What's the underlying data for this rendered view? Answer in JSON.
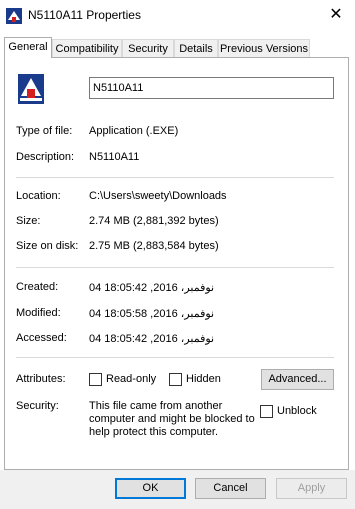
{
  "window": {
    "title": "N5110A11 Properties",
    "close_glyph": "✕"
  },
  "tabs": [
    "General",
    "Compatibility",
    "Security",
    "Details",
    "Previous Versions"
  ],
  "file": {
    "name": "N5110A11"
  },
  "details": {
    "type_label": "Type of file:",
    "type_value": "Application (.EXE)",
    "description_label": "Description:",
    "description_value": "N5110A11",
    "location_label": "Location:",
    "location_value": "C:\\Users\\sweety\\Downloads",
    "size_label": "Size:",
    "size_value": "2.74 MB (2,881,392 bytes)",
    "size_on_disk_label": "Size on disk:",
    "size_on_disk_value": "2.75 MB (2,883,584 bytes)",
    "created_label": "Created:",
    "created_value": "04 نوفمبر، 2016, 18:05:42",
    "modified_label": "Modified:",
    "modified_value": "04 نوفمبر، 2016, 18:05:58",
    "accessed_label": "Accessed:",
    "accessed_value": "04 نوفمبر، 2016, 18:05:42"
  },
  "attributes": {
    "label": "Attributes:",
    "readonly_label": "Read-only",
    "hidden_label": "Hidden",
    "advanced_button": "Advanced..."
  },
  "security": {
    "label": "Security:",
    "message": "This file came from another\ncomputer and might be blocked to\nhelp protect this computer.",
    "unblock_label": "Unblock"
  },
  "buttons": {
    "ok": "OK",
    "cancel": "Cancel",
    "apply": "Apply"
  },
  "colors": {
    "icon_blue": "#1a3a8c",
    "icon_red": "#d42020",
    "accent": "#0078d7"
  }
}
